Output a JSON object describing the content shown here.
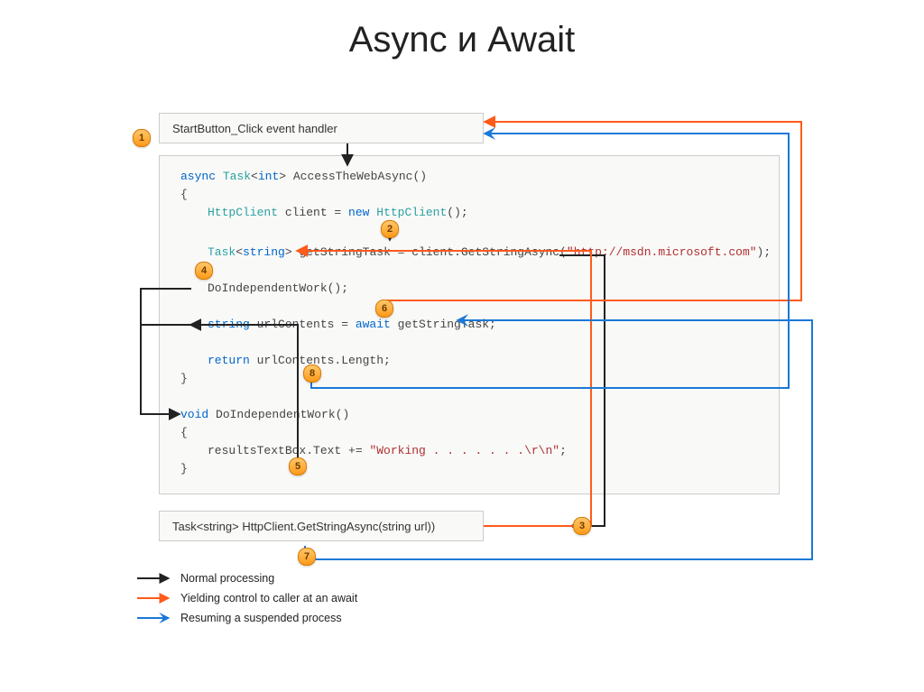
{
  "title": "Async и Await",
  "boxes": {
    "top": "StartButton_Click event handler",
    "bottom": "Task<string> HttpClient.GetStringAsync(string url))"
  },
  "code": {
    "line1_kw": "async ",
    "line1_type": "Task",
    "line1_generic": "<",
    "line1_int": "int",
    "line1_generic2": "> ",
    "line1_name": "AccessTheWebAsync()",
    "line2": "{",
    "line3_type": "HttpClient ",
    "line3_mid": "client = ",
    "line3_new": "new ",
    "line3_type2": "HttpClient",
    "line3_end": "();",
    "line4_type": "Task",
    "line4_g1": "<",
    "line4_str": "string",
    "line4_g2": "> ",
    "line4_mid": "getStringTask = client.GetStringAsync(",
    "line4_url": "\"http://msdn.microsoft.com\"",
    "line4_end": ");",
    "line5": "DoIndependentWork();",
    "line6_str": "string ",
    "line6_mid": "urlContents = ",
    "line6_await": "await ",
    "line6_end": "getStringTask;",
    "line7_ret": "return ",
    "line7_end": "urlContents.Length;",
    "line8": "}",
    "line9_void": "void ",
    "line9_name": "DoIndependentWork()",
    "line10": "{",
    "line11_mid": "resultsTextBox.Text += ",
    "line11_str": "\"Working . . . . . . .\\r\\n\"",
    "line11_end": ";",
    "line12": "}"
  },
  "badges": {
    "b1": "1",
    "b2": "2",
    "b3": "3",
    "b4": "4",
    "b5": "5",
    "b6": "6",
    "b7": "7",
    "b8": "8"
  },
  "legend": {
    "l1": "Normal processing",
    "l2": "Yielding control to caller at an await",
    "l3": "Resuming a suspended process"
  }
}
